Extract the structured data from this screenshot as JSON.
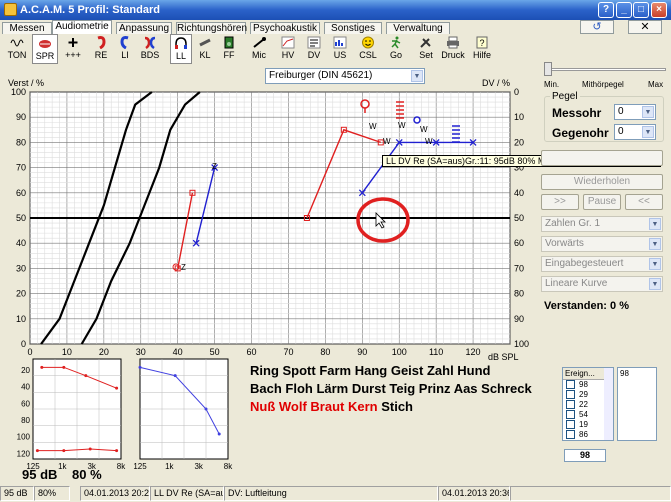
{
  "window": {
    "title": "A.C.A.M. 5  Profil: Standard",
    "help": "?",
    "minimize": "_",
    "maximize": "□",
    "close": "×"
  },
  "menu": {
    "undo_icon": "undo-icon",
    "undo_glyph": "↺",
    "mute_glyph": "✕"
  },
  "tabs": [
    "Messen",
    "Audiometrie",
    "Anpassung",
    "Richtungshören",
    "Psychoakustik",
    "Sonstiges",
    "Verwaltung"
  ],
  "toolbar": [
    "TON",
    "SPR",
    "+++",
    "RE",
    "LI",
    "BDS",
    "LL",
    "KL",
    "FF",
    "Mic",
    "HV",
    "DV",
    "US",
    "CSL",
    "Go",
    "Set",
    "Druck",
    "Hilfe"
  ],
  "test_select": "Freiburger (DIN 45621)",
  "graph": {
    "ylabel_left": "Verst / %",
    "ylabel_right": "DV / %",
    "xlabel": "dB SPL",
    "x_ticks": [
      "0",
      "10",
      "20",
      "30",
      "40",
      "50",
      "60",
      "70",
      "80",
      "90",
      "100",
      "110",
      "120"
    ],
    "y_ticks_left": [
      "100",
      "90",
      "80",
      "70",
      "60",
      "50",
      "40",
      "30",
      "20",
      "10",
      "0"
    ],
    "y_ticks_right": [
      "0",
      "10",
      "20",
      "30",
      "40",
      "50",
      "60",
      "70",
      "80",
      "90",
      "100"
    ],
    "marker_labels": {
      "z": "Z",
      "w": "W"
    }
  },
  "chart_data": [
    {
      "type": "line",
      "xlabel": "dB SPL",
      "ylabel": "Verst / %",
      "xlim": [
        0,
        130
      ],
      "ylim": [
        0,
        100
      ],
      "grid": true,
      "series": [
        {
          "color": "#000000",
          "x": [
            3,
            8,
            12,
            16,
            20,
            23,
            26,
            28.5,
            33
          ],
          "y": [
            0,
            10,
            25,
            40,
            55,
            70,
            85,
            95,
            100
          ]
        },
        {
          "color": "#000000",
          "x": [
            14,
            18,
            22,
            27,
            31,
            35,
            38,
            42,
            46
          ],
          "y": [
            0,
            10,
            25,
            40,
            55,
            70,
            85,
            95,
            100
          ]
        },
        {
          "color": "#e02020",
          "x": [
            40,
            44
          ],
          "y": [
            30,
            60
          ]
        },
        {
          "color": "#2020d0",
          "x": [
            45,
            50
          ],
          "y": [
            40,
            70
          ]
        },
        {
          "color": "#e02020",
          "x": [
            75,
            85,
            95
          ],
          "y": [
            50,
            85,
            80
          ]
        },
        {
          "color": "#2020d0",
          "x": [
            90,
            100,
            110,
            120
          ],
          "y": [
            60,
            80,
            80,
            80
          ]
        }
      ]
    },
    {
      "type": "line",
      "xlabel": "",
      "x_ticks": [
        "125",
        "1k",
        "3k",
        "8k"
      ],
      "y_ticks": [
        "20",
        "40",
        "60",
        "80",
        "100",
        "120"
      ],
      "series": [
        {
          "color": "#e02020",
          "x": [
            0.1,
            0.35,
            0.6,
            0.95
          ],
          "y": [
            10,
            10,
            20,
            35
          ]
        },
        {
          "color": "#e02020",
          "x": [
            0.05,
            0.35,
            0.65,
            0.95
          ],
          "y": [
            110,
            110,
            108,
            110
          ]
        }
      ]
    },
    {
      "type": "line",
      "xlabel": "",
      "x_ticks": [
        "125",
        "1k",
        "3k",
        "8k"
      ],
      "series": [
        {
          "color": "#4040e0",
          "x": [
            0.0,
            0.4,
            0.75,
            0.9
          ],
          "y": [
            10,
            20,
            60,
            90
          ]
        }
      ]
    }
  ],
  "tooltip": "LL DV Re (SA=aus)Gr.:11:  95dB  80% Messohr:95dB Gegenohr:0dB",
  "right_panel": {
    "slider_min": "Min.",
    "slider_mid": "Mithörpegel",
    "slider_max": "Max",
    "pegel": "Pegel",
    "messohr": "Messohr",
    "messohr_val": "0",
    "gegenohr": "Gegenohr",
    "gegenohr_val": "0",
    "wiederholen": "Wiederholen",
    "btn_prev": ">>",
    "btn_pause": "Pause",
    "btn_next": "<<",
    "dd1": "Zahlen Gr. 1",
    "dd2": "Vorwärts",
    "dd3": "Eingabegesteuert",
    "dd4": "Lineare Kurve",
    "verstanden": "Verstanden: 0 %"
  },
  "words": {
    "line1": "Ring Spott Farm Hang Geist Zahl Hund",
    "line2": "Bach Floh Lärm Durst Teig Prinz Aas Schreck",
    "line3_red": "Nuß Wolf Braut Kern",
    "line3_black": " Stich"
  },
  "result": {
    "level": "95 dB",
    "percent": "80 %"
  },
  "events": {
    "header": "Ereign...",
    "items": [
      "98",
      "29",
      "22",
      "54",
      "19",
      "86",
      "71"
    ],
    "value": "98",
    "side_value": "98"
  },
  "status": {
    "level": "95 dB",
    "percent": "80%",
    "date1": "04.01.2013 20:29:13",
    "info": "LL DV Re (SA=aus)Gr",
    "mode": "DV: Luftleitung",
    "date2": "04.01.2013 20:36:09"
  }
}
